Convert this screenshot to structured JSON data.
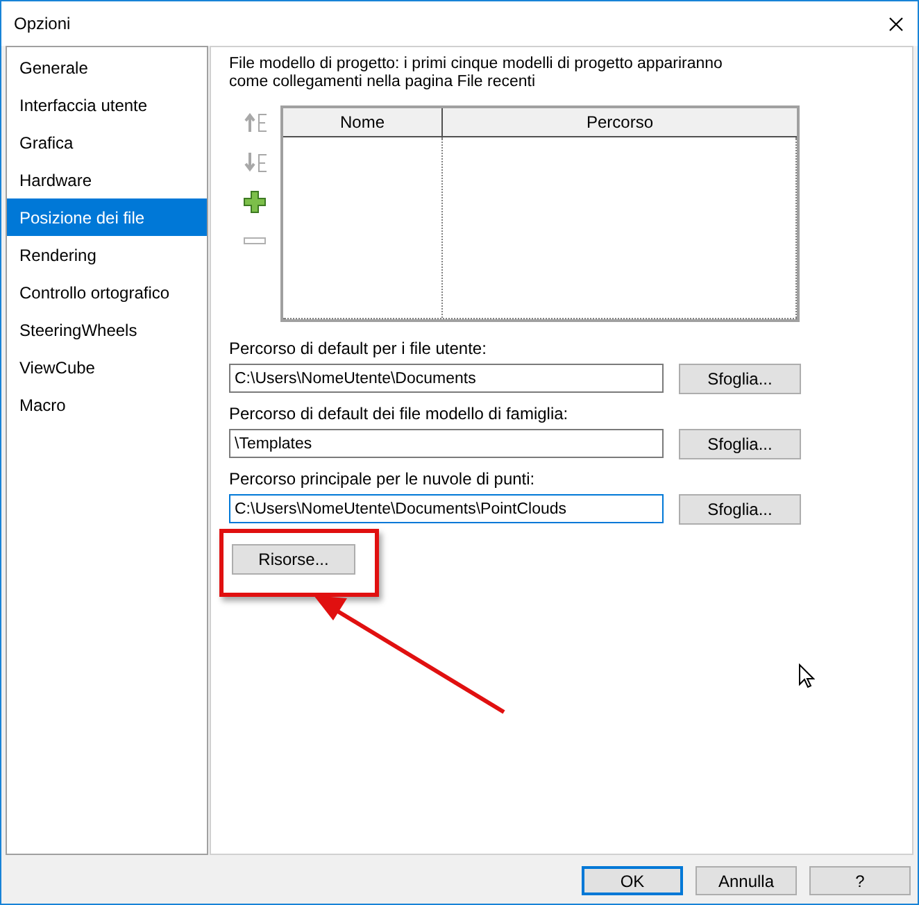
{
  "window": {
    "title": "Opzioni"
  },
  "sidebar": {
    "items": [
      {
        "label": "Generale",
        "selected": false
      },
      {
        "label": "Interfaccia utente",
        "selected": false
      },
      {
        "label": "Grafica",
        "selected": false
      },
      {
        "label": "Hardware",
        "selected": false
      },
      {
        "label": "Posizione dei file",
        "selected": true
      },
      {
        "label": "Rendering",
        "selected": false
      },
      {
        "label": "Controllo ortografico",
        "selected": false
      },
      {
        "label": "SteeringWheels",
        "selected": false
      },
      {
        "label": "ViewCube",
        "selected": false
      },
      {
        "label": "Macro",
        "selected": false
      }
    ]
  },
  "description": "File modello di progetto: i primi cinque modelli di progetto appariranno come collegamenti nella pagina File recenti",
  "table": {
    "columns": [
      "Nome",
      "Percorso"
    ]
  },
  "paths": [
    {
      "label": "Percorso di default per i file utente:",
      "value": "C:\\Users\\NomeUtente\\Documents",
      "focused": false,
      "button": "Sfoglia..."
    },
    {
      "label": "Percorso di default dei file modello di famiglia:",
      "value": "\\Templates",
      "focused": false,
      "button": "Sfoglia..."
    },
    {
      "label": "Percorso principale per le nuvole di punti:",
      "value": "C:\\Users\\NomeUtente\\Documents\\PointClouds",
      "focused": true,
      "button": "Sfoglia..."
    }
  ],
  "resources_button": "Risorse...",
  "buttons": [
    {
      "label": "OK",
      "default": true
    },
    {
      "label": "Annulla",
      "default": false
    },
    {
      "label": "?",
      "default": false
    }
  ]
}
